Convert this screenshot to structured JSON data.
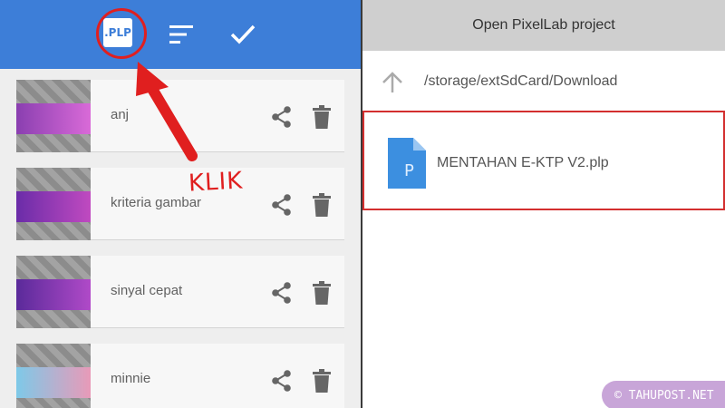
{
  "toolbar": {
    "plp_label": ".PLP",
    "accent": "#3d7ed8"
  },
  "projects": [
    {
      "name": "anj",
      "thumb_colors": [
        "#8a3fb0",
        "#d96ad8"
      ]
    },
    {
      "name": "kriteria gambar",
      "thumb_colors": [
        "#6a2ca8",
        "#c04ac0"
      ]
    },
    {
      "name": "sinyal cepat",
      "thumb_colors": [
        "#5a2a9a",
        "#b04ac8"
      ]
    },
    {
      "name": "minnie",
      "thumb_colors": [
        "#7ec9e8",
        "#e89ab8"
      ]
    }
  ],
  "dialog": {
    "title": "Open PixelLab project",
    "path": "/storage/extSdCard/Download",
    "file_name": "MENTAHAN E-KTP V2.plp",
    "file_icon_letter": "P"
  },
  "annotation": {
    "callout_text": "KLIK",
    "color": "#e01f1f"
  },
  "watermark": {
    "text": "© TAHUPOST.NET"
  }
}
